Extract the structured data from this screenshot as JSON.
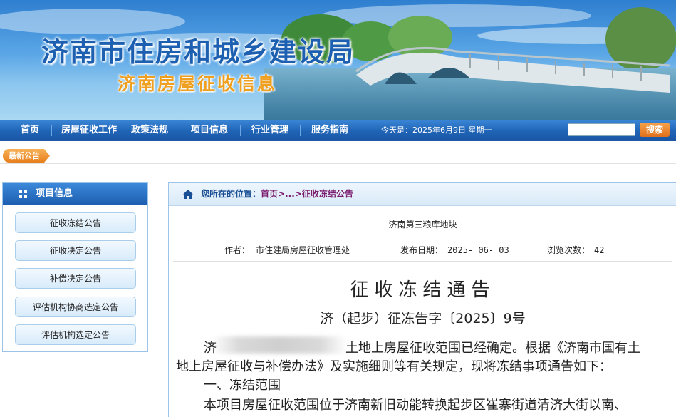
{
  "header": {
    "site_title": "济南市住房和城乡建设局",
    "site_subtitle": "济南房屋征收信息"
  },
  "nav": {
    "items": [
      "首页",
      "房屋征收工作",
      "政策法规",
      "项目信息",
      "行业管理",
      "服务指南"
    ],
    "date_text": "今天是：2025年6月9日  星期一",
    "search_button": "搜索",
    "search_value": ""
  },
  "notice": {
    "label": "最新公告"
  },
  "sidebar": {
    "title": "项目信息",
    "items": [
      "征收冻结公告",
      "征收决定公告",
      "补偿决定公告",
      "评估机构协商选定公告",
      "评估机构选定公告"
    ]
  },
  "breadcrumb": {
    "prefix": "您所在的位置：",
    "home": "首页",
    "ellipsis": ">...>",
    "current": "征收冻结公告"
  },
  "article": {
    "project_name": "济南第三粮库地块",
    "author_label": "作者：",
    "author": "市住建局房屋征收管理处",
    "date_label": "发布日期：",
    "date": "2025- 06- 03",
    "views_label": "浏览次数：",
    "views": "42",
    "title": "征收冻结通告",
    "doc_number": "济（起步）征冻告字〔2025〕9号",
    "para1_start": "济",
    "para1_rest": "土地上房屋征收范围已经确定。根据《济南市国有土",
    "para1_line2": "地上房屋征收与补偿办法》及实施细则等有关规定，现将冻结事项通告如下：",
    "section1": "一、冻结范围",
    "para2": "本项目房屋征收范围位于济南新旧动能转换起步区崔寨街道清济大街以南、"
  },
  "colors": {
    "nav_blue": "#1f63b5",
    "title_blue": "#1d5fb0",
    "subtitle_orange": "#f0a020",
    "accent_orange": "#e77f1c",
    "breadcrumb_link": "#7a1b6e"
  }
}
